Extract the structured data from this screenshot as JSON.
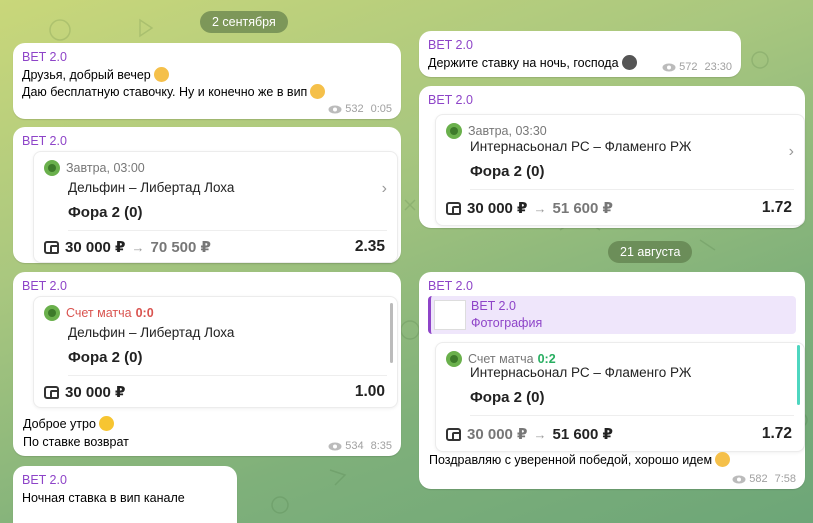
{
  "date_pills": [
    "2 сентября",
    "21 августа"
  ],
  "channel": "BET 2.0",
  "left": [
    {
      "lines": [
        "Друзья, добрый вечер",
        "Даю бесплатную ставочку. Ну и конечно же в вип"
      ],
      "views": "532",
      "time": "0:05"
    },
    {
      "card": {
        "when": "Завтра, 03:00",
        "teams": "Дельфин – Либертад Лоха",
        "fora": "Фора 2 (0)",
        "stake": "30 000 ₽",
        "win": "70 500 ₽",
        "odds": "2.35"
      }
    },
    {
      "card": {
        "score_label": "Счет матча",
        "score": "0:0",
        "teams": "Дельфин – Либертад Лоха",
        "fora": "Фора 2 (0)",
        "stake": "30 000 ₽",
        "odds": "1.00"
      },
      "lines": [
        "Доброе утро",
        "По ставке возврат"
      ],
      "views": "534",
      "time": "8:35"
    },
    {
      "lines": [
        "Ночная ставка в вип канале"
      ]
    }
  ],
  "right": [
    {
      "lines": [
        "Держите ставку на ночь, господа"
      ],
      "views": "572",
      "time": "23:30"
    },
    {
      "card": {
        "when": "Завтра, 03:30",
        "teams": "Интернасьонал РС – Фламенго РЖ",
        "fora": "Фора 2 (0)",
        "stake": "30 000 ₽",
        "win": "51 600 ₽",
        "odds": "1.72"
      }
    },
    {
      "reply": {
        "name": "BET 2.0",
        "type": "Фотография"
      },
      "card": {
        "score_label": "Счет матча",
        "score": "0:2",
        "teams": "Интернасьонал РС – Фламенго РЖ",
        "fora": "Фора 2 (0)",
        "stake": "30 000 ₽",
        "win": "51 600 ₽",
        "odds": "1.72"
      },
      "lines": [
        "Поздравляю с  уверенной победой, хорошо идем"
      ],
      "views": "582",
      "time": "7:58"
    }
  ],
  "colors": {
    "sender": "#8e44c8",
    "score_lost": "#d9534f",
    "score_won": "#27ae60"
  }
}
